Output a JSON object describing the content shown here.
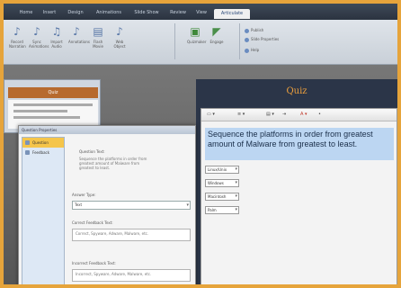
{
  "ribbon": {
    "tabs": [
      "Home",
      "Insert",
      "Design",
      "Animations",
      "Slide Show",
      "Review",
      "View",
      "Articulate"
    ],
    "active_tab": "Articulate",
    "buttons": [
      {
        "icon": "narration-icon",
        "label": "Record Narration"
      },
      {
        "icon": "sync-icon",
        "label": "Sync Animations"
      },
      {
        "icon": "import-icon",
        "label": "Import Audio"
      },
      {
        "icon": "annotation-icon",
        "label": "Annotations"
      },
      {
        "icon": "flash-icon",
        "label": "Flash Movie"
      },
      {
        "icon": "web-object-icon",
        "label": "Web Object"
      },
      {
        "icon": "quiz-icon",
        "label": "Quizmaker"
      },
      {
        "icon": "engage-icon",
        "label": "Engage"
      }
    ],
    "small_items": [
      "Publish",
      "Slide Properties",
      "Help"
    ]
  },
  "thumbnail": {
    "title": "Quiz"
  },
  "slide": {
    "title": "Quiz"
  },
  "quiz": {
    "question": "Sequence the platforms in order from greatest amount of Malware from greatest to least.",
    "answers": [
      "Linux/Unix",
      "Windows",
      "Macintosh",
      "Palm"
    ]
  },
  "dialog": {
    "title": "Question Properties",
    "nav": [
      {
        "icon": "question-icon",
        "label": "Question"
      },
      {
        "icon": "feedback-icon",
        "label": "Feedback"
      }
    ],
    "labels": {
      "question_text": "Question Text:",
      "question_type": "Answer Type:",
      "correct_feedback": "Correct Feedback Text:",
      "incorrect_feedback": "Incorrect Feedback Text:"
    },
    "question_text": "Sequence the platforms in order from greatest amount of Malware from greatest to least.",
    "question_type": "Text",
    "correct_feedback": "Correct, Spyware, Adware, Malware, etc.",
    "incorrect_feedback": "Incorrect, Spyware, Adware, Malware, etc."
  }
}
